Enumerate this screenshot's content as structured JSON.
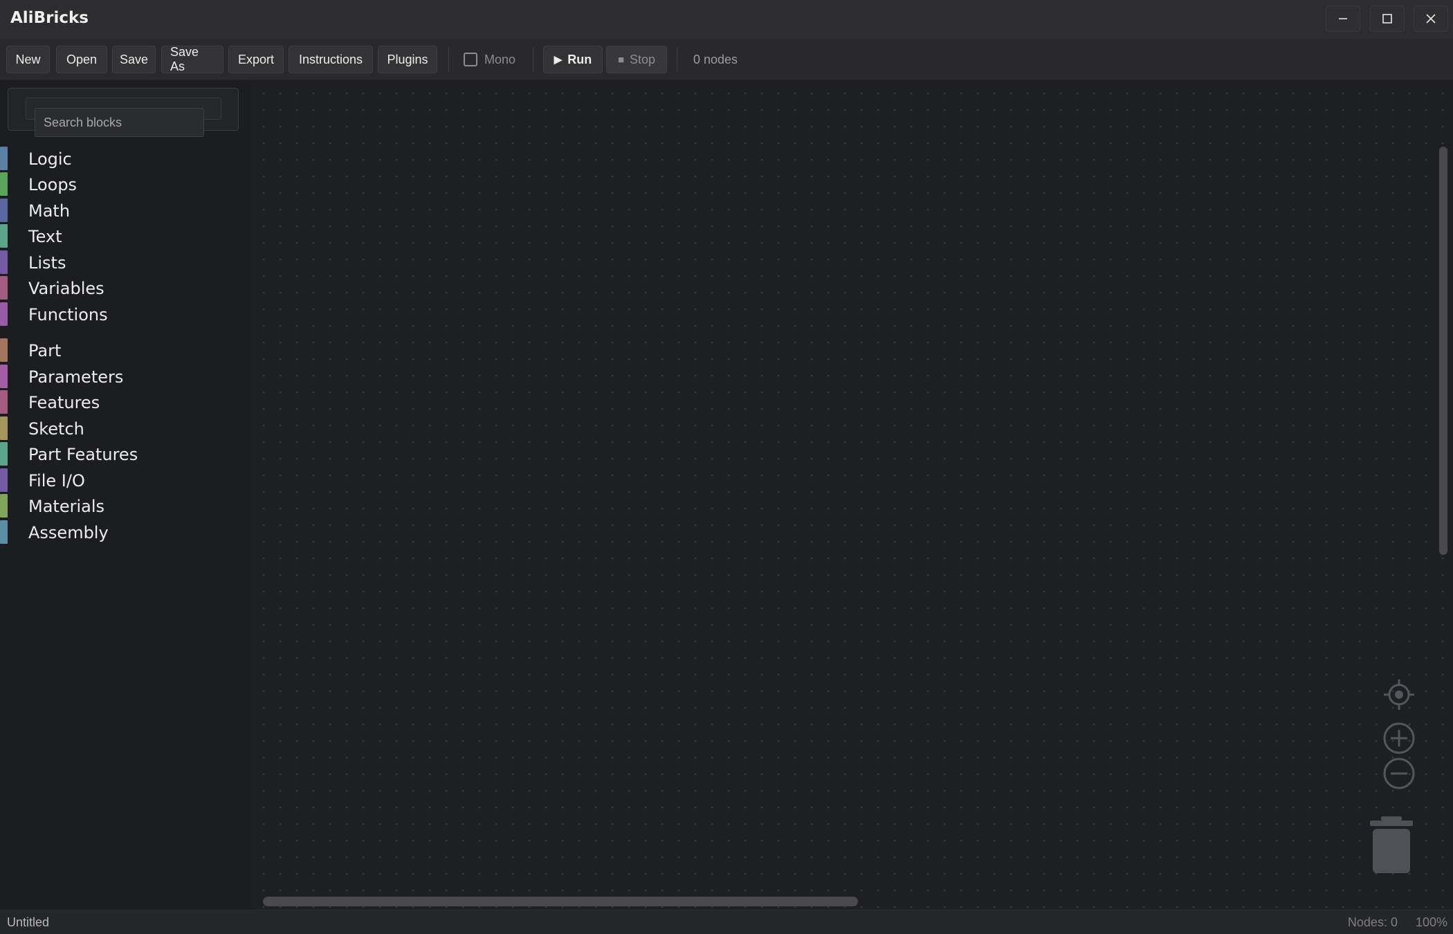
{
  "window": {
    "title": "AliBricks",
    "controls": [
      "minimize",
      "maximize",
      "close"
    ]
  },
  "toolbar": {
    "new_label": "New",
    "open_label": "Open",
    "save_label": "Save",
    "save_as_label": "Save As",
    "export_label": "Export",
    "instructions_label": "Instructions",
    "plugins_label": "Plugins",
    "mono_label": "Mono",
    "mono_checked": false,
    "run_label": "Run",
    "run_glyph": "▶",
    "stop_label": "Stop",
    "stop_glyph": "■",
    "node_count": "0 nodes"
  },
  "sidebar": {
    "search": {
      "placeholder": "Search blocks",
      "value": ""
    },
    "categories": [
      {
        "label": "Logic",
        "color": "#5b80a5"
      },
      {
        "label": "Loops",
        "color": "#5ba55b"
      },
      {
        "label": "Math",
        "color": "#5b67a5"
      },
      {
        "label": "Text",
        "color": "#5ba58c"
      },
      {
        "label": "Lists",
        "color": "#745ba5"
      },
      {
        "label": "Variables",
        "color": "#a55b80"
      },
      {
        "label": "Functions",
        "color": "#995ba5"
      },
      {
        "label": "Part",
        "color": "#a5745b"
      },
      {
        "label": "Parameters",
        "color": "#a55ba5"
      },
      {
        "label": "Features",
        "color": "#a55b80"
      },
      {
        "label": "Sketch",
        "color": "#a5955b"
      },
      {
        "label": "Part Features",
        "color": "#5ba58c"
      },
      {
        "label": "File I/O",
        "color": "#745ba5"
      },
      {
        "label": "Materials",
        "color": "#80a55b"
      },
      {
        "label": "Assembly",
        "color": "#5b8fa5"
      }
    ]
  },
  "canvas": {
    "icons": [
      "crosshair-icon",
      "zoom-in-icon",
      "zoom-out-icon",
      "trash-icon"
    ]
  },
  "status": {
    "document": "Untitled",
    "nodes": "Nodes: 0",
    "zoom": "100%"
  }
}
